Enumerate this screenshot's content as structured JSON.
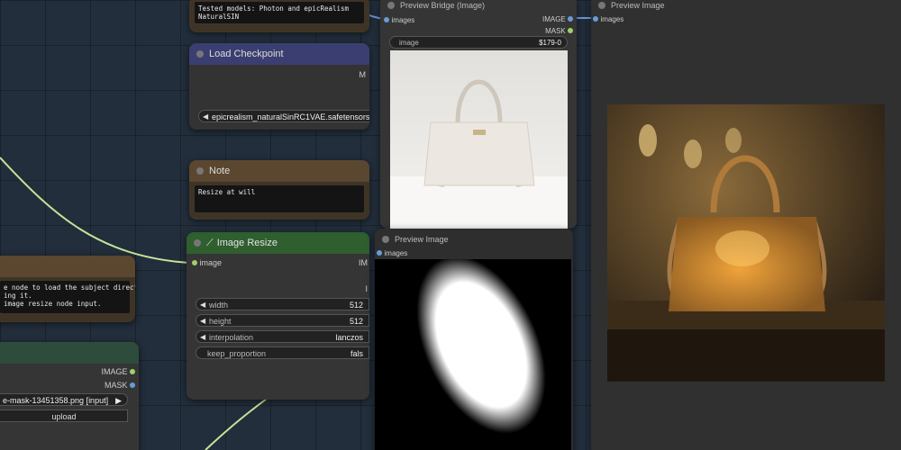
{
  "nodes": {
    "top_note": {
      "text": "Tested models: Photon and epicRealism NaturalSIN"
    },
    "load_checkpoint": {
      "title": "Load Checkpoint",
      "output_label": "M",
      "ckpt_value": "epicrealism_naturalSinRC1VAE.safetensors"
    },
    "note2": {
      "title": "Note",
      "text": "Resize at will"
    },
    "image_resize": {
      "title": "Image Resize",
      "input_label": "image",
      "output_label": "IM",
      "widgets": [
        {
          "label": "width",
          "value": "512"
        },
        {
          "label": "height",
          "value": "512"
        },
        {
          "label": "interpolation",
          "value": "lanczos"
        },
        {
          "label": "keep_proportion",
          "value": "fals"
        }
      ]
    },
    "left_note": {
      "text": "e node to load the subject directly\ning it.\nimage resize node input."
    },
    "load_image": {
      "out_image": "IMAGE",
      "out_mask": "MASK",
      "file": "e-mask-13451358.png [input]",
      "upload": "upload"
    },
    "preview_bridge": {
      "title": "Preview Bridge (Image)",
      "input_label": "images",
      "out_image": "IMAGE",
      "out_mask": "MASK",
      "widget_label": "image",
      "widget_value": "$179-0"
    },
    "preview_image_mid": {
      "title": "Preview Image",
      "input_label": "images"
    },
    "preview_image_right": {
      "title": "Preview Image",
      "input_label": "images"
    }
  },
  "colors": {
    "accent_link": "#c7e39a",
    "image_link": "#6a9bd8"
  }
}
